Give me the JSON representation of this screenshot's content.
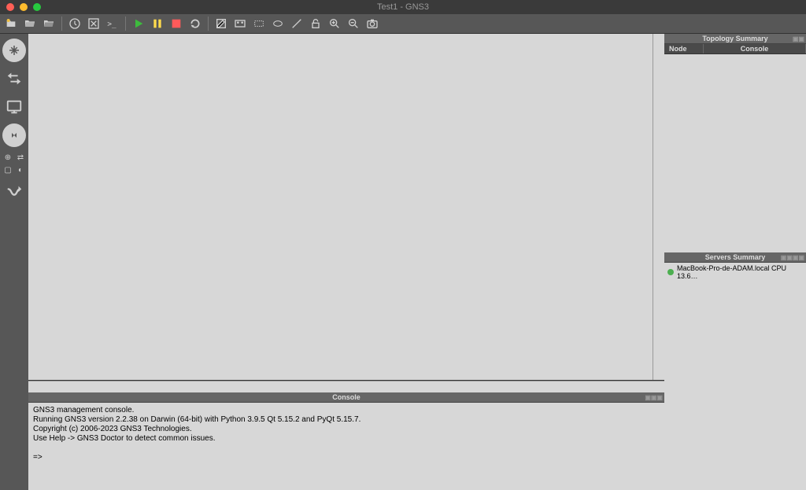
{
  "window": {
    "title": "Test1 - GNS3"
  },
  "panels": {
    "console_title": "Console",
    "topology_title": "Topology Summary",
    "servers_title": "Servers Summary"
  },
  "topology": {
    "col_node": "Node",
    "col_console": "Console"
  },
  "servers": [
    {
      "name": "MacBook-Pro-de-ADAM.local CPU 13.6…"
    }
  ],
  "console": {
    "line1": "GNS3 management console.",
    "line2": "Running GNS3 version 2.2.38 on Darwin (64-bit) with Python 3.9.5 Qt 5.15.2 and PyQt 5.15.7.",
    "line3": "Copyright (c) 2006-2023 GNS3 Technologies.",
    "line4": "Use Help -> GNS3 Doctor to detect common issues.",
    "prompt": "=>"
  }
}
